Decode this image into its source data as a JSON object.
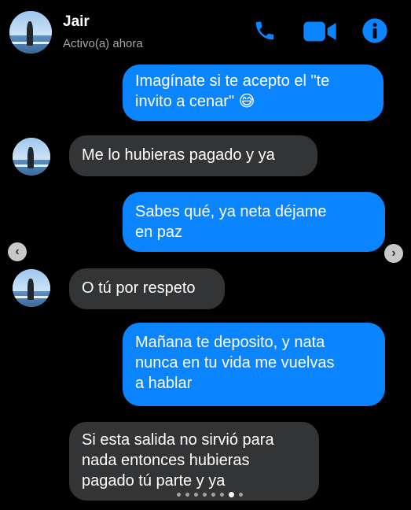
{
  "contact": {
    "name": "Jair",
    "status": "Activo(a) ahora",
    "avatar_icon": "profile-photo"
  },
  "header_icons": {
    "call": "phone-icon",
    "video": "video-camera-icon",
    "info": "info-icon",
    "accent_color": "#0a84ff"
  },
  "messages": [
    {
      "direction": "outgoing",
      "text": "Imagínate si te acepto el \"te\ninvito a cenar\" 😅"
    },
    {
      "direction": "incoming",
      "text": "Me lo hubieras pagado y ya"
    },
    {
      "direction": "outgoing",
      "text": "Sabes qué, ya neta déjame\nen paz"
    },
    {
      "direction": "incoming",
      "text": "O tú por respeto"
    },
    {
      "direction": "outgoing",
      "text": "Mañana te deposito, y nata\nnunca en tu vida me vuelvas\na hablar"
    },
    {
      "direction": "incoming",
      "text": "Si esta salida no sirvió para\nnada entonces hubieras\npagado tú parte y ya"
    }
  ],
  "carousel": {
    "prev_glyph": "‹",
    "next_glyph": "›",
    "page_count": 8,
    "active_page": 6
  },
  "colors": {
    "outgoing_bubble": "#0a84ff",
    "incoming_bubble": "#333436",
    "background": "#000000"
  }
}
